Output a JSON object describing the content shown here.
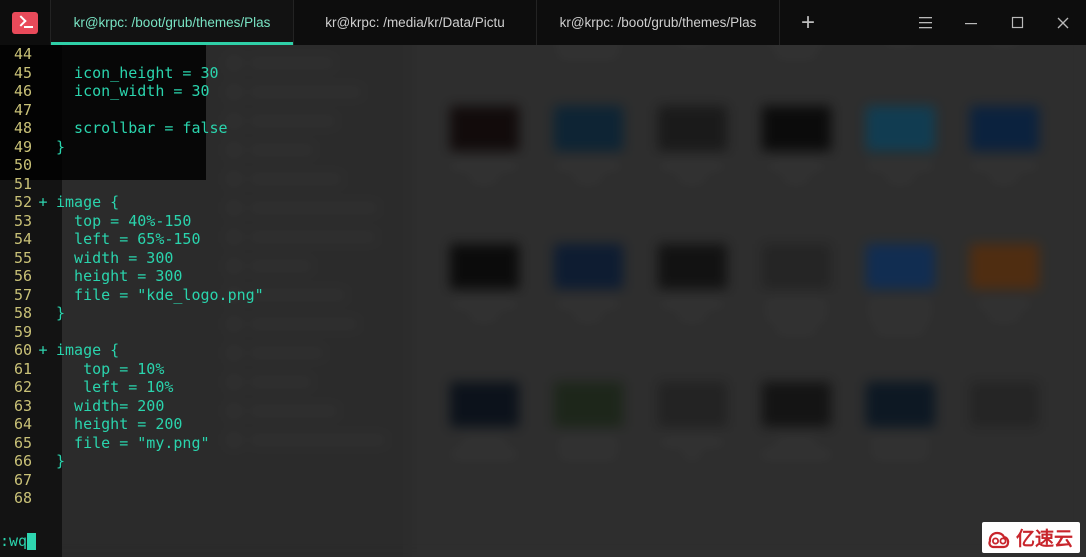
{
  "window": {
    "app_icon": "terminal-icon",
    "tabs": [
      {
        "label": "kr@krpc: /boot/grub/themes/Plas",
        "active": true
      },
      {
        "label": "kr@krpc: /media/kr/Data/Pictu",
        "active": false
      },
      {
        "label": "kr@krpc: /boot/grub/themes/Plas",
        "active": false
      }
    ],
    "new_tab_label": "+",
    "controls": [
      {
        "name": "menu-button",
        "glyph": "☰"
      },
      {
        "name": "minimize-button",
        "glyph": "—"
      },
      {
        "name": "maximize-button",
        "glyph": "□"
      },
      {
        "name": "close-button",
        "glyph": "✕"
      }
    ],
    "accent_color": "#2fd0a8",
    "tabbar_bg": "#0d0d0d"
  },
  "editor": {
    "text_color": "#2ad4ad",
    "linenum_color": "#c9c177",
    "lines": [
      {
        "num": "44",
        "sign": "",
        "text": ""
      },
      {
        "num": "45",
        "sign": "",
        "text": "  icon_height = 30"
      },
      {
        "num": "46",
        "sign": "",
        "text": "  icon_width = 30"
      },
      {
        "num": "47",
        "sign": "",
        "text": ""
      },
      {
        "num": "48",
        "sign": "",
        "text": "  scrollbar = false"
      },
      {
        "num": "49",
        "sign": "",
        "text": "}"
      },
      {
        "num": "50",
        "sign": "",
        "text": ""
      },
      {
        "num": "51",
        "sign": "",
        "text": ""
      },
      {
        "num": "52",
        "sign": "+",
        "text": "image {"
      },
      {
        "num": "53",
        "sign": "",
        "text": "  top = 40%-150"
      },
      {
        "num": "54",
        "sign": "",
        "text": "  left = 65%-150"
      },
      {
        "num": "55",
        "sign": "",
        "text": "  width = 300"
      },
      {
        "num": "56",
        "sign": "",
        "text": "  height = 300"
      },
      {
        "num": "57",
        "sign": "",
        "text": "  file = \"kde_logo.png\""
      },
      {
        "num": "58",
        "sign": "",
        "text": "}"
      },
      {
        "num": "59",
        "sign": "",
        "text": ""
      },
      {
        "num": "60",
        "sign": "+",
        "text": "image {"
      },
      {
        "num": "61",
        "sign": "",
        "text": "   top = 10%"
      },
      {
        "num": "62",
        "sign": "",
        "text": "   left = 10%"
      },
      {
        "num": "63",
        "sign": "",
        "text": "  width= 200"
      },
      {
        "num": "64",
        "sign": "",
        "text": "  height = 200"
      },
      {
        "num": "65",
        "sign": "",
        "text": "  file = \"my.png\""
      },
      {
        "num": "66",
        "sign": "",
        "text": "}"
      },
      {
        "num": "67",
        "sign": "",
        "text": ""
      },
      {
        "num": "68",
        "sign": "",
        "text": ""
      }
    ],
    "command_line": ":wq"
  },
  "background": {
    "sidebar_items": [
      {
        "width": 84
      },
      {
        "width": 112
      },
      {
        "width": 86
      },
      {
        "width": 64
      },
      {
        "width": 92
      },
      {
        "width": 128
      },
      {
        "width": 126
      },
      {
        "width": 62
      },
      {
        "width": 96
      },
      {
        "width": 108
      },
      {
        "width": 74
      },
      {
        "width": 62
      },
      {
        "width": 88
      },
      {
        "width": 136
      }
    ],
    "thumbnails": [
      {
        "color": "#0f4c66",
        "labels": [
          22
        ]
      },
      {
        "color": "#081a3a",
        "labels": [
          66,
          66,
          60
        ]
      },
      {
        "color": "#4a3222",
        "labels": [
          66,
          30
        ]
      },
      {
        "color": "#1a1a1a",
        "labels": [
          60,
          56,
          40
        ]
      },
      {
        "color": "#17334d",
        "labels": [
          58,
          30
        ]
      },
      {
        "color": "#123a52",
        "labels": [
          64,
          28
        ]
      },
      {
        "color": "#130a0a",
        "labels": [
          66,
          26
        ]
      },
      {
        "color": "#0d2d44",
        "labels": [
          64,
          26
        ]
      },
      {
        "color": "#1f1f1f",
        "labels": [
          62,
          26
        ]
      },
      {
        "color": "#0a0a0a",
        "labels": [
          54,
          24
        ]
      },
      {
        "color": "#12506e",
        "labels": [
          66,
          26
        ]
      },
      {
        "color": "#0a2a52",
        "labels": [
          66,
          26
        ]
      },
      {
        "color": "#0a0a0a",
        "labels": [
          64,
          26
        ]
      },
      {
        "color": "#0d2240",
        "labels": [
          62,
          26
        ]
      },
      {
        "color": "#141414",
        "labels": [
          62,
          26
        ]
      },
      {
        "color": "#2e2e2e",
        "labels": [
          62,
          60,
          40
        ]
      },
      {
        "color": "#123a6e",
        "labels": [
          64,
          62,
          50
        ]
      },
      {
        "color": "#6b3a12",
        "labels": [
          52,
          30
        ]
      },
      {
        "color": "#0b1420",
        "labels": [
          44,
          66
        ]
      },
      {
        "color": "#23301f",
        "labels": [
          60,
          58
        ]
      },
      {
        "color": "#2b2b2b",
        "labels": [
          62,
          16
        ]
      },
      {
        "color": "#161616",
        "labels": [
          38,
          70
        ]
      },
      {
        "color": "#0c1c2c",
        "labels": [
          60,
          56
        ]
      },
      {
        "color": "#2e2e2e",
        "labels": [
          0
        ]
      }
    ]
  },
  "watermark": {
    "text": "亿速云",
    "logo_color": "#c8252c"
  }
}
